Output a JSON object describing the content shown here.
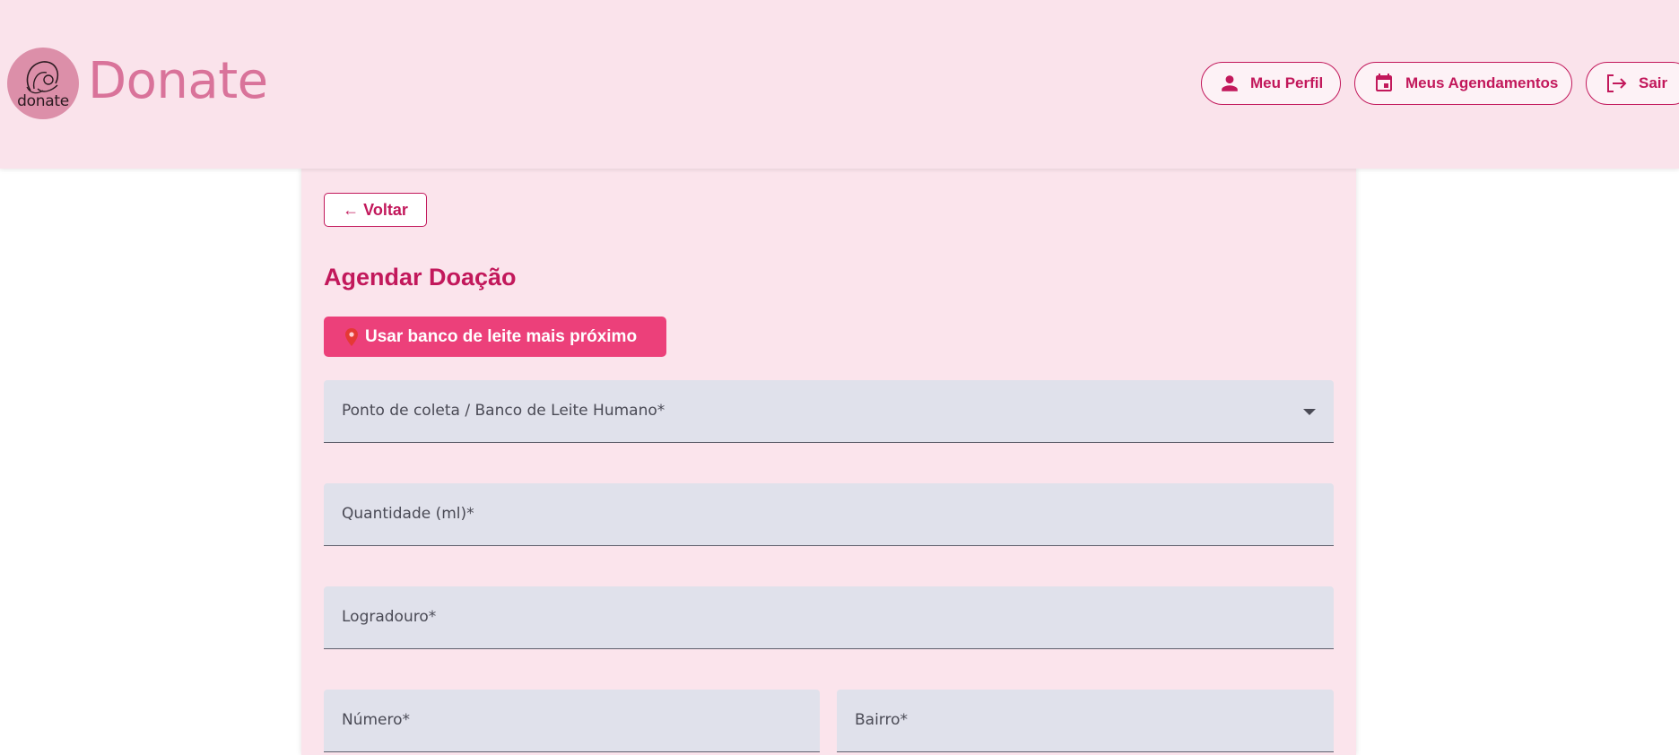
{
  "header": {
    "logo_text": "donate",
    "brand": "Donate",
    "nav": {
      "profile_label": "Meu Perfil",
      "appointments_label": "Meus Agendamentos",
      "logout_label": "Sair"
    }
  },
  "main": {
    "back_label": "← Voltar",
    "title": "Agendar Doação",
    "nearest_button_label": "Usar banco de leite mais próximo",
    "fields": {
      "collection_point": "Ponto de coleta / Banco de Leite Humano*",
      "quantity": "Quantidade (ml)*",
      "street": "Logradouro*",
      "number": "Número*",
      "neighborhood": "Bairro*"
    }
  },
  "colors": {
    "header_bg": "#fae3eb",
    "accent": "#c2185b",
    "button_pink": "#ec407a",
    "brand_pink": "#d9739a",
    "field_bg": "#e0e1eb"
  }
}
